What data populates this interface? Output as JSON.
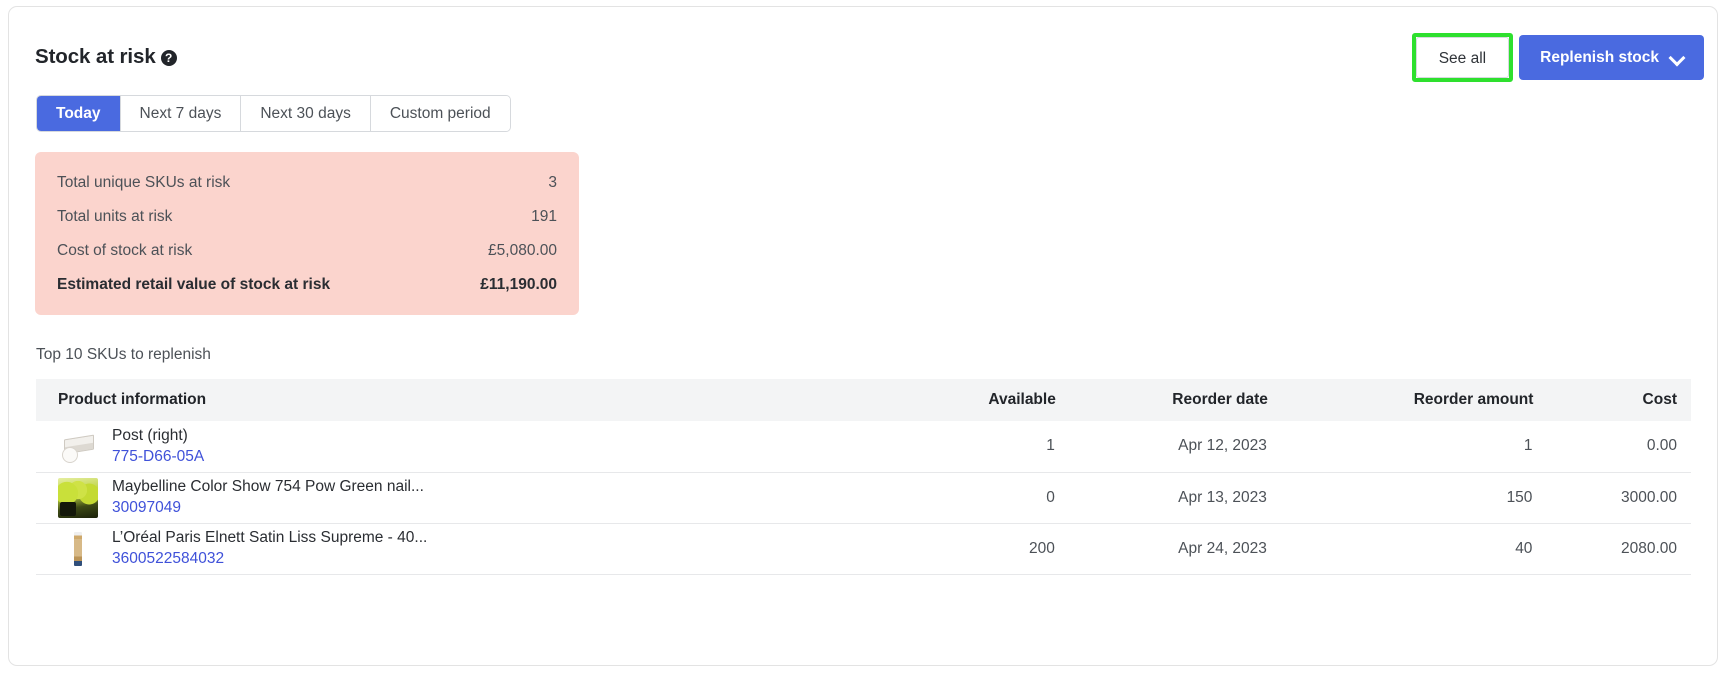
{
  "card": {
    "title": "Stock at risk",
    "help_icon": "help-circle-icon"
  },
  "header_actions": {
    "see_all_label": "See all",
    "replenish_label": "Replenish stock",
    "replenish_chevron": "chevron-down-icon",
    "highlight_color": "#2ee02e",
    "primary_color": "#4a6ae0"
  },
  "tabs": [
    {
      "label": "Today",
      "active": true
    },
    {
      "label": "Next 7 days",
      "active": false
    },
    {
      "label": "Next 30 days",
      "active": false
    },
    {
      "label": "Custom period",
      "active": false
    }
  ],
  "stats": {
    "background_color": "#fbd4cd",
    "rows": [
      {
        "label": "Total unique SKUs at risk",
        "value": "3",
        "bold": false
      },
      {
        "label": "Total units at risk",
        "value": "191",
        "bold": false
      },
      {
        "label": "Cost of stock at risk",
        "value": "£5,080.00",
        "bold": false
      },
      {
        "label": "Estimated retail value of stock at risk",
        "value": "£11,190.00",
        "bold": true
      }
    ]
  },
  "table": {
    "caption": "Top 10 SKUs to replenish",
    "columns": [
      "Product information",
      "Available",
      "Reorder date",
      "Reorder amount",
      "Cost"
    ],
    "rows": [
      {
        "thumb": "bed-post-thumbnail",
        "name": "Post (right)",
        "sku": "775-D66-05A",
        "available": "1",
        "reorder_date": "Apr 12, 2023",
        "reorder_amount": "1",
        "cost": "0.00"
      },
      {
        "thumb": "nail-polish-thumbnail",
        "name": "Maybelline Color Show 754 Pow Green nail...",
        "sku": "30097049",
        "available": "0",
        "reorder_date": "Apr 13, 2023",
        "reorder_amount": "150",
        "cost": "3000.00"
      },
      {
        "thumb": "hairspray-thumbnail",
        "name": "L’Oréal Paris Elnett Satin Liss Supreme - 40...",
        "sku": "3600522584032",
        "available": "200",
        "reorder_date": "Apr 24, 2023",
        "reorder_amount": "40",
        "cost": "2080.00"
      }
    ]
  }
}
